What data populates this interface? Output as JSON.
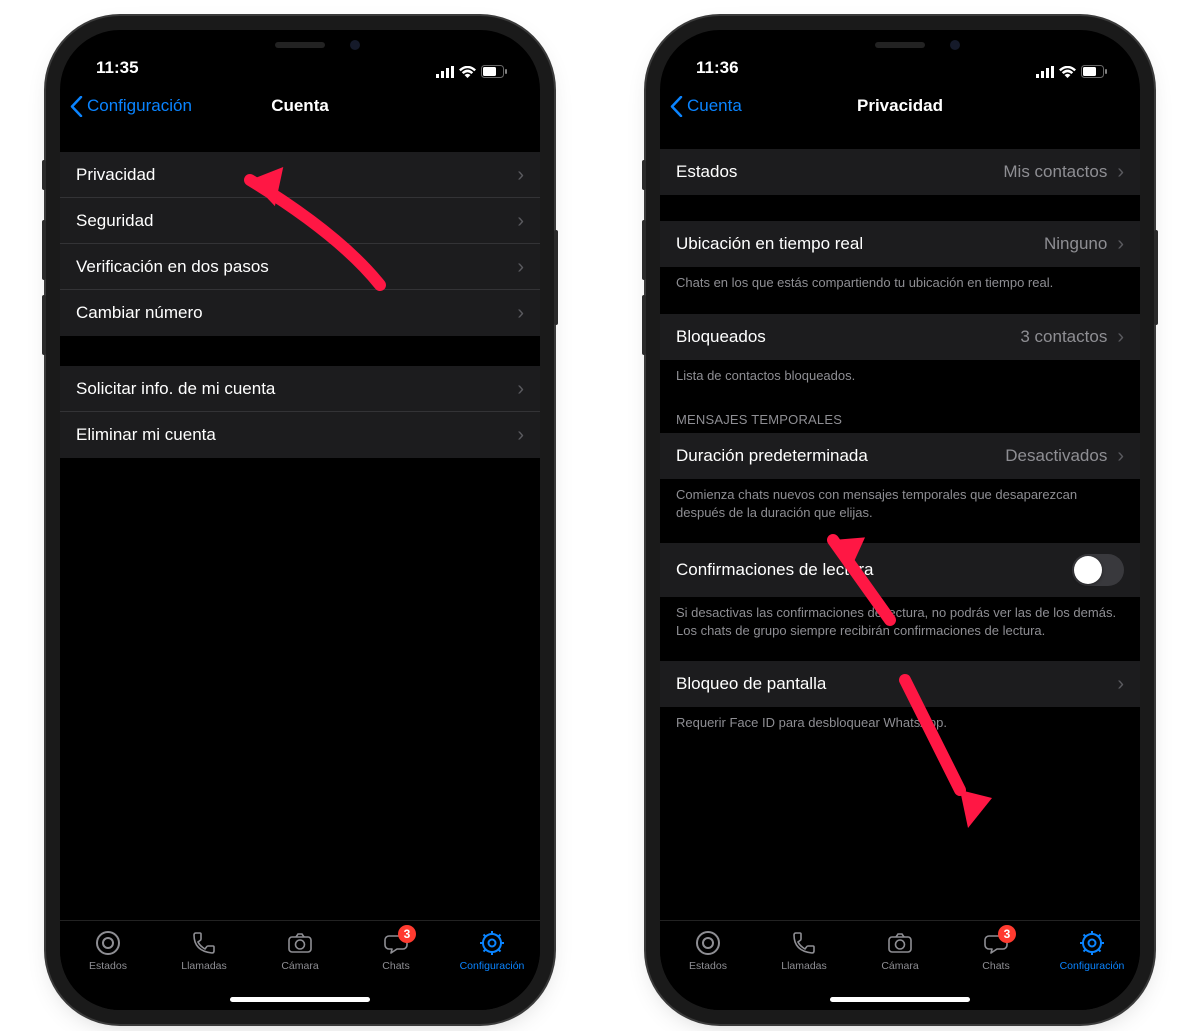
{
  "colors": {
    "accent": "#0a84ff",
    "badge": "#ff3b30",
    "arrow": "#ff1744"
  },
  "phone1": {
    "time": "11:35",
    "back_label": "Configuración",
    "title": "Cuenta",
    "group1": [
      {
        "label": "Privacidad"
      },
      {
        "label": "Seguridad"
      },
      {
        "label": "Verificación en dos pasos"
      },
      {
        "label": "Cambiar número"
      }
    ],
    "group2": [
      {
        "label": "Solicitar info. de mi cuenta"
      },
      {
        "label": "Eliminar mi cuenta"
      }
    ]
  },
  "phone2": {
    "time": "11:36",
    "back_label": "Cuenta",
    "title": "Privacidad",
    "estados": {
      "label": "Estados",
      "value": "Mis contactos"
    },
    "ubicacion": {
      "label": "Ubicación en tiempo real",
      "value": "Ninguno"
    },
    "ubicacion_footer": "Chats en los que estás compartiendo tu ubicación en tiempo real.",
    "bloqueados": {
      "label": "Bloqueados",
      "value": "3 contactos"
    },
    "bloqueados_footer": "Lista de contactos bloqueados.",
    "temp_header": "MENSAJES TEMPORALES",
    "duracion": {
      "label": "Duración predeterminada",
      "value": "Desactivados"
    },
    "duracion_footer": "Comienza chats nuevos con mensajes temporales que desaparezcan después de la duración que elijas.",
    "read_receipts": {
      "label": "Confirmaciones de lectura"
    },
    "read_footer": "Si desactivas las confirmaciones de lectura, no podrás ver las de los demás. Los chats de grupo siempre recibirán confirmaciones de lectura.",
    "screen_lock": {
      "label": "Bloqueo de pantalla"
    },
    "lock_footer": "Requerir Face ID para desbloquear WhatsApp."
  },
  "tabs": {
    "items": [
      {
        "label": "Estados"
      },
      {
        "label": "Llamadas"
      },
      {
        "label": "Cámara"
      },
      {
        "label": "Chats",
        "badge": "3"
      },
      {
        "label": "Configuración",
        "active": true
      }
    ]
  }
}
